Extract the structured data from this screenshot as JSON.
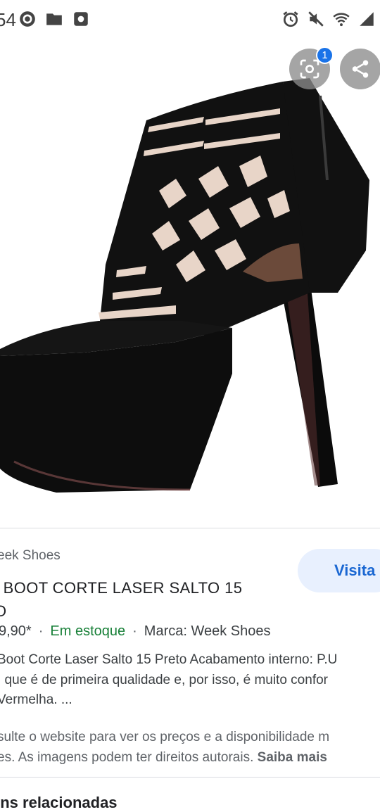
{
  "status_bar": {
    "time": "54",
    "left_icons": [
      "whatsapp-icon",
      "folder-icon",
      "screenshot-icon"
    ],
    "right_icons": [
      "alarm-icon",
      "mute-icon",
      "wifi-icon",
      "signal-icon"
    ]
  },
  "viewer": {
    "image_subject": "black platform peep-toe bootie",
    "lens_badge_count": "1"
  },
  "product": {
    "source": "eek Shoes",
    "visit_label": "Visita",
    "title": "| BOOT CORTE LASER SALTO 15\nO",
    "price": "9,90*",
    "stock": "Em estoque",
    "brand": "Marca: Week Shoes",
    "description": "Boot Corte Laser Salto 15 Preto Acabamento interno: P.U\n, que é de primeira qualidade e, por isso, é muito confor\nVermelha. ...",
    "disclaimer": "sulte o website para ver os preços e a disponibilidade m\nes. As imagens podem ter direitos autorais. ",
    "learn_more": "Saiba mais"
  },
  "related": {
    "heading": "ens relacionadas"
  }
}
